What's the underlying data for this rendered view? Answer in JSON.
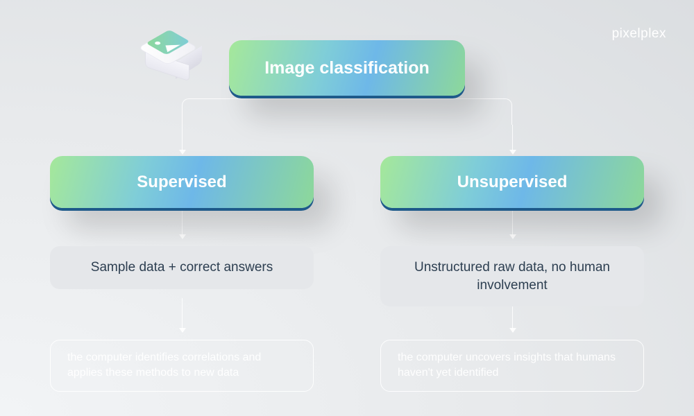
{
  "logo": "pixelplex",
  "root": {
    "title": "Image classification"
  },
  "branches": {
    "left": {
      "title": "Supervised",
      "description": "Sample data +  correct answers",
      "outcome": "the computer identifies correlations and applies these methods to new data"
    },
    "right": {
      "title": "Unsupervised",
      "description": "Unstructured raw data, no human involvement",
      "outcome": "the computer uncovers insights that humans haven't yet identified"
    }
  }
}
